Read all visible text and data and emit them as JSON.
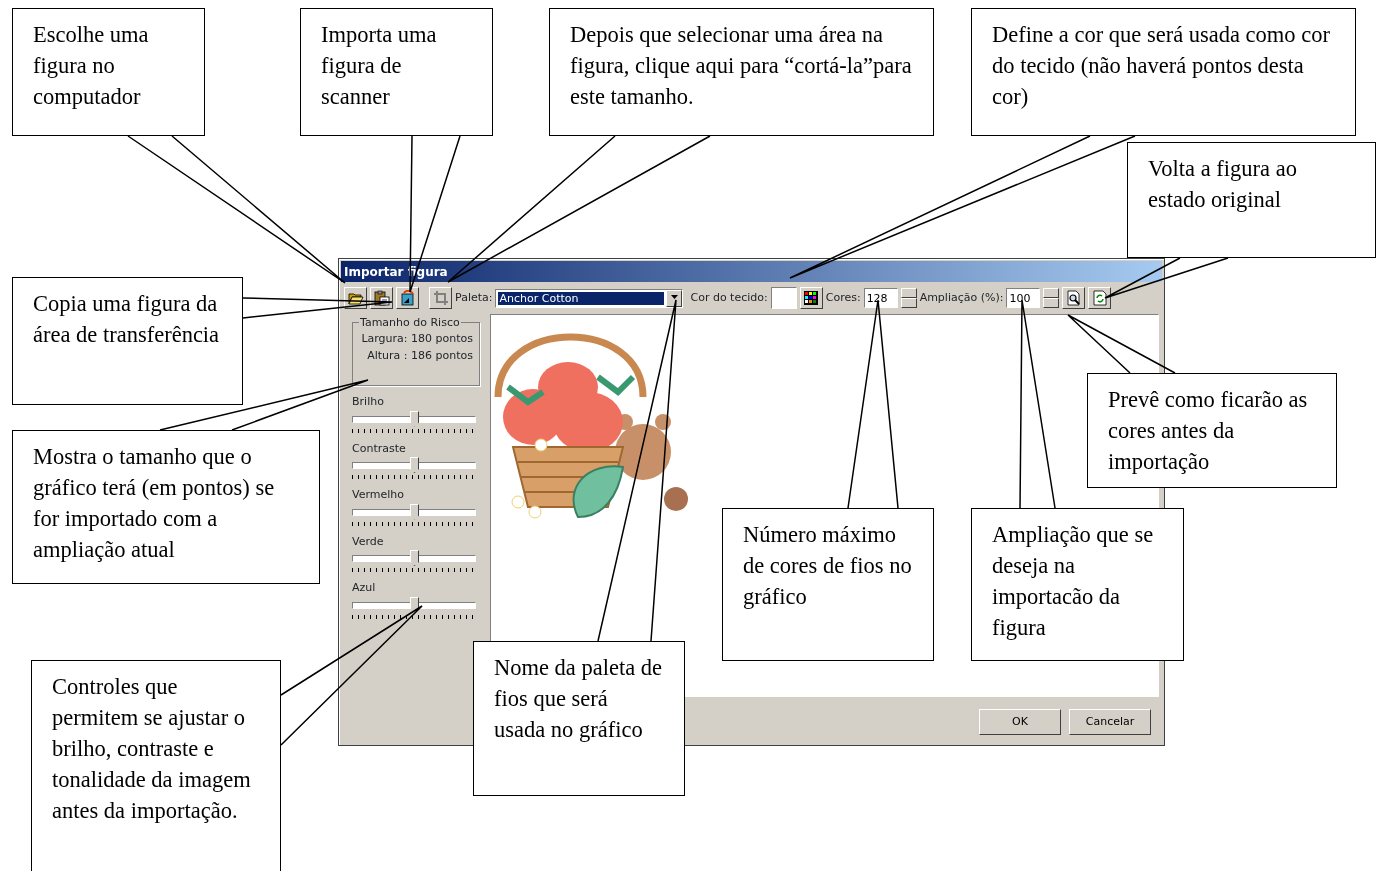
{
  "dialog": {
    "title": "Importar figura",
    "toolbar": {
      "palette_label": "Paleta:",
      "palette_value": "Anchor Cotton",
      "fabric_label": "Cor do tecido:",
      "colors_label": "Cores:",
      "colors_value": "128",
      "zoom_label": "Ampliação (%):",
      "zoom_value": "100"
    },
    "size_group": {
      "title": "Tamanho do Risco",
      "width": "Largura: 180 pontos",
      "height": "Altura : 186 pontos"
    },
    "sliders": [
      {
        "label": "Brilho",
        "level": 0.5
      },
      {
        "label": "Contraste",
        "level": 0.5
      },
      {
        "label": "Vermelho",
        "level": 0.5
      },
      {
        "label": "Verde",
        "level": 0.5
      },
      {
        "label": "Azul",
        "level": 0.5
      }
    ],
    "buttons": [
      "OK",
      "Cancelar"
    ]
  },
  "callouts": [
    {
      "text": "Escolhe uma figura no computador"
    },
    {
      "text": "Importa uma figura de scanner"
    },
    {
      "text": "Depois que selecionar uma área na figura, clique aqui para “cortá-la”para este tamanho."
    },
    {
      "text": "Define a cor que será usada como cor do tecido (não haverá pontos desta cor)"
    },
    {
      "text": "Volta a figura ao estado original"
    },
    {
      "text": "Copia uma figura da área de transferência"
    },
    {
      "text": "Mostra o tamanho que o gráfico terá (em pontos) se for importado com a ampliação atual"
    },
    {
      "text": "Controles que permitem se ajustar o brilho, contraste e tonalidade da imagem antes da importação."
    },
    {
      "text": "Nome da paleta de fios que será usada no gráfico"
    },
    {
      "text": "Número máximo de cores de fios no gráfico"
    },
    {
      "text": "Ampliação que se deseja na importacão da figura"
    },
    {
      "text": "Prevê como ficarão as cores antes da importação"
    }
  ]
}
